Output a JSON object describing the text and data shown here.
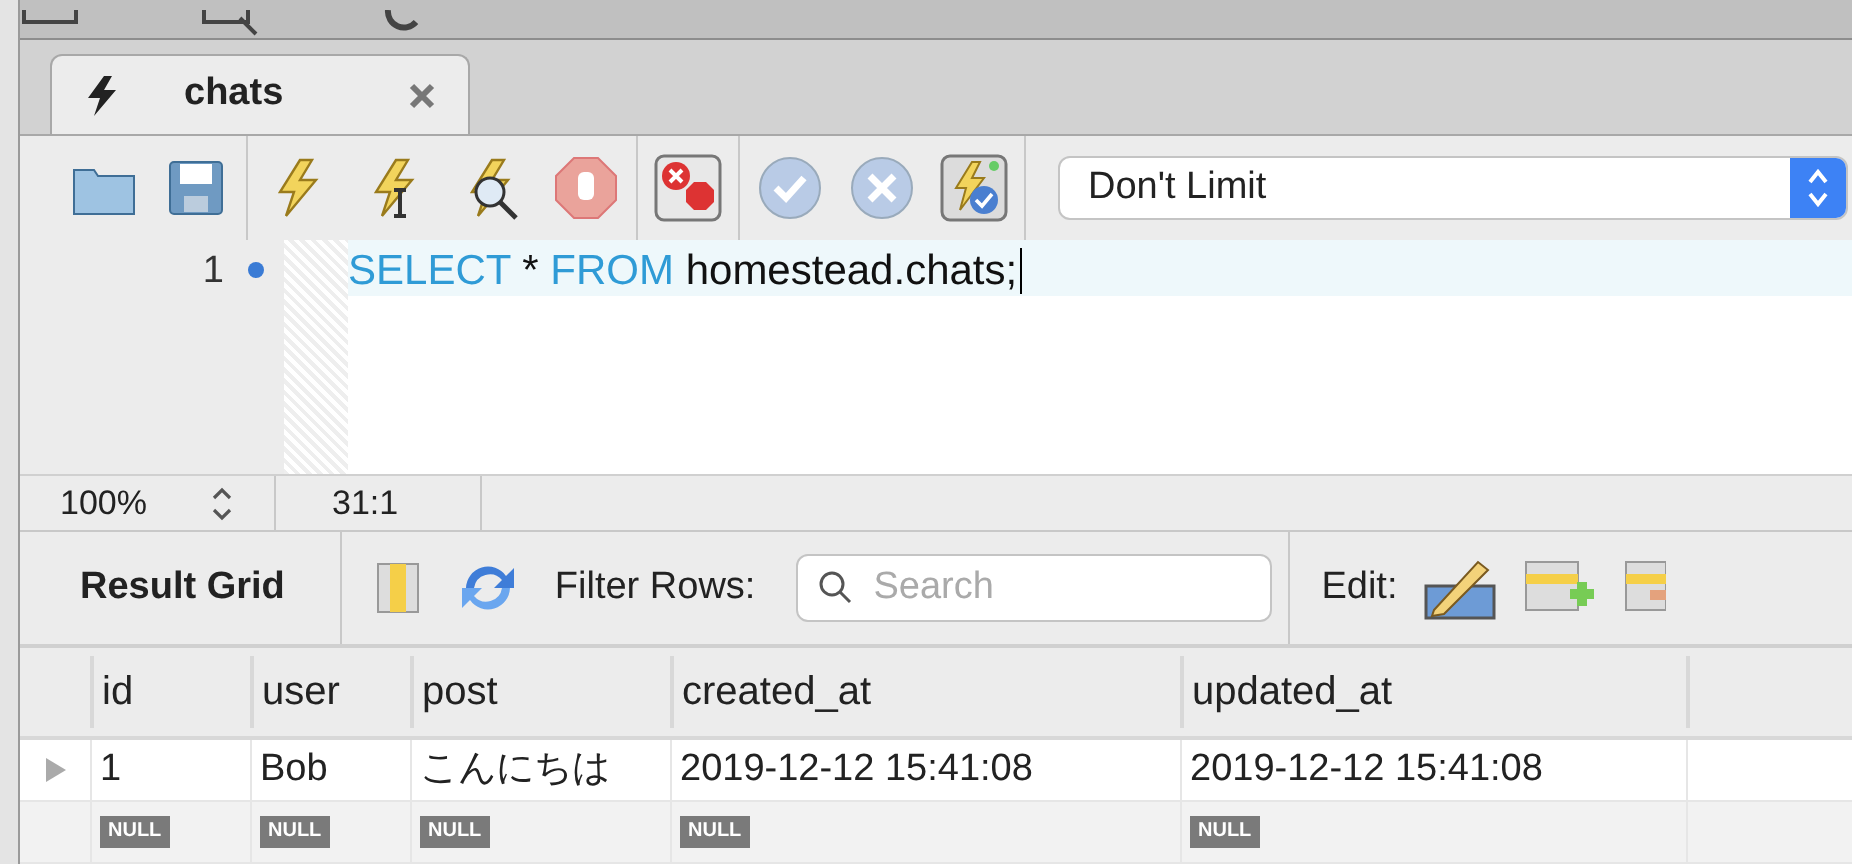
{
  "tab": {
    "title": "chats",
    "selected": true
  },
  "limit_select": {
    "value": "Don't Limit"
  },
  "editor": {
    "lines": [
      {
        "number": "1",
        "current": true,
        "tokens": [
          {
            "text": "SELECT",
            "kind": "keyword"
          },
          {
            "text": " * ",
            "kind": "plain"
          },
          {
            "text": "FROM",
            "kind": "keyword"
          },
          {
            "text": " homestead.chats;",
            "kind": "plain"
          }
        ]
      }
    ]
  },
  "status_bar": {
    "zoom": "100%",
    "position": "31:1"
  },
  "results_toolbar": {
    "title": "Result Grid",
    "filter_label": "Filter Rows:",
    "search": {
      "placeholder": "Search"
    },
    "edit_label": "Edit:"
  },
  "table": {
    "columns": [
      "id",
      "user",
      "post",
      "created_at",
      "updated_at"
    ],
    "rows": [
      {
        "current": true,
        "cells": [
          {
            "kind": "value",
            "text": "1"
          },
          {
            "kind": "value",
            "text": "Bob"
          },
          {
            "kind": "value",
            "text": "こんにちは"
          },
          {
            "kind": "value",
            "text": "2019-12-12 15:41:08"
          },
          {
            "kind": "value",
            "text": "2019-12-12 15:41:08"
          }
        ]
      },
      {
        "current": false,
        "cells": [
          {
            "kind": "null",
            "text": "NULL"
          },
          {
            "kind": "null",
            "text": "NULL"
          },
          {
            "kind": "null",
            "text": "NULL"
          },
          {
            "kind": "null",
            "text": "NULL"
          },
          {
            "kind": "null",
            "text": "NULL"
          }
        ]
      }
    ]
  }
}
